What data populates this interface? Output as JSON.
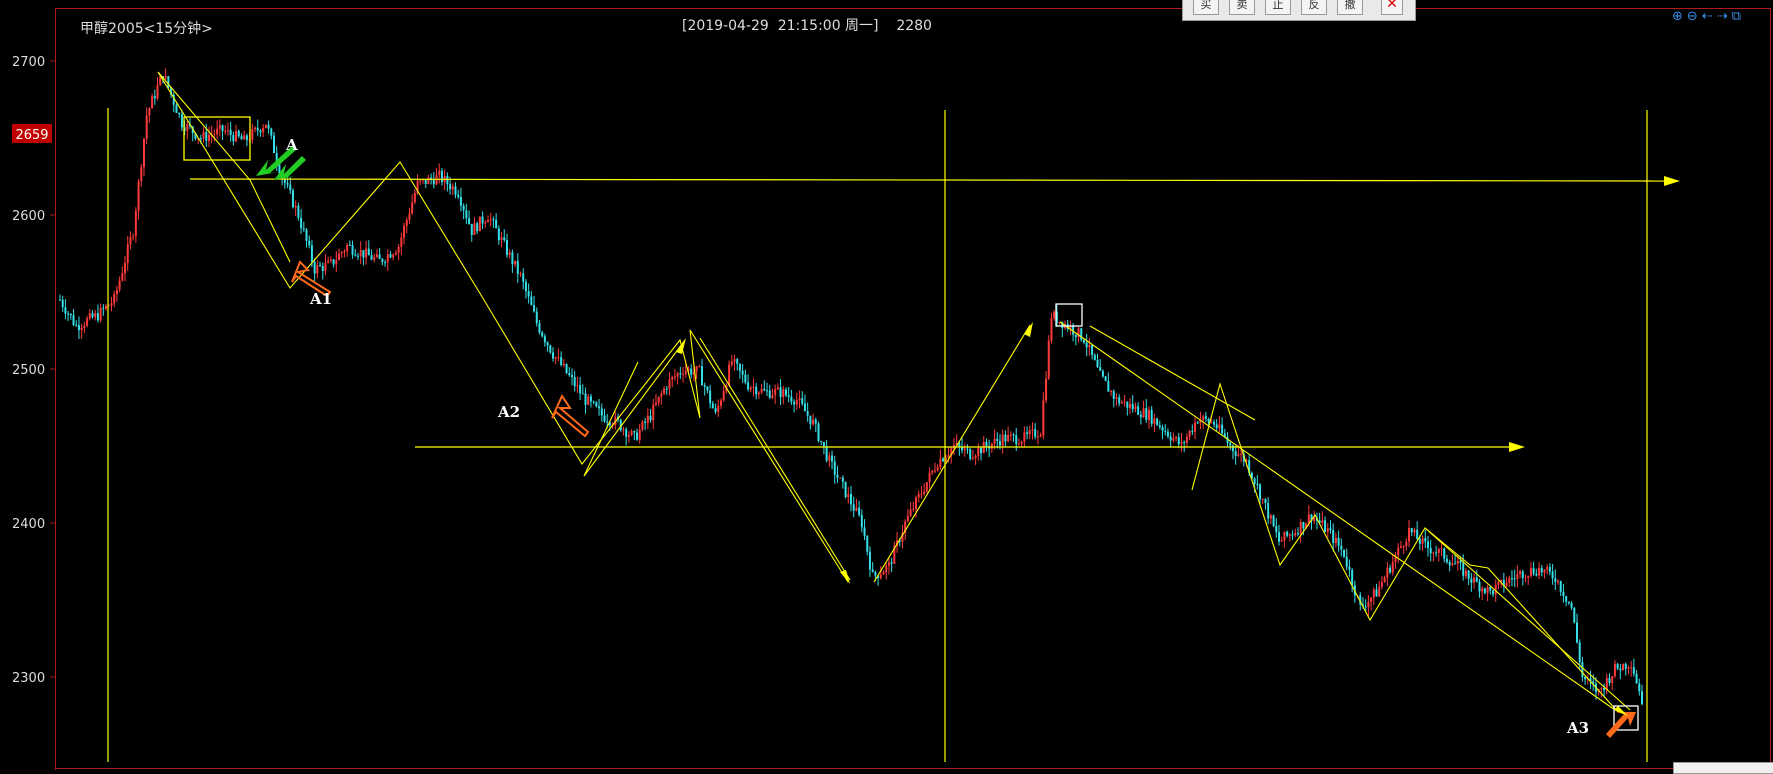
{
  "header": {
    "symbol": "甲醇2005<15分钟>",
    "info": "[2019-04-29  21:15:00 周一]    2280"
  },
  "toolbar": {
    "buttons": [
      "买",
      "卖",
      "止",
      "反",
      "撤"
    ],
    "close_icon": "close-icon"
  },
  "corner_icons": [
    "zoom-in-icon",
    "zoom-out-icon",
    "scroll-left-icon",
    "scroll-right-icon",
    "expand-icon"
  ],
  "price_tag": "2659",
  "annotations": [
    "A",
    "A1",
    "A2",
    "A3"
  ],
  "colors": {
    "background": "#000000",
    "up": "#ff3a3a",
    "down": "#35e0e8",
    "lines": "#ffff00",
    "frame": "#b0191e",
    "label_bg": "#c00000",
    "green_arrow": "#22cc22",
    "orange_arrow": "#ff6a1a"
  },
  "chart_data": {
    "type": "candlestick",
    "title": "甲醇2005<15分钟>",
    "y_ticks": [
      2700,
      2600,
      2500,
      2400,
      2300
    ],
    "ylim": [
      2245,
      2730
    ],
    "highlight_price": 2659,
    "horizontal_levels": [
      2622,
      2448
    ],
    "price_path": [
      [
        0,
        2545
      ],
      [
        6,
        2528
      ],
      [
        14,
        2535
      ],
      [
        20,
        2545
      ],
      [
        27,
        2590
      ],
      [
        32,
        2665
      ],
      [
        38,
        2692
      ],
      [
        45,
        2660
      ],
      [
        52,
        2650
      ],
      [
        60,
        2655
      ],
      [
        68,
        2648
      ],
      [
        76,
        2660
      ],
      [
        82,
        2625
      ],
      [
        88,
        2600
      ],
      [
        94,
        2565
      ],
      [
        100,
        2568
      ],
      [
        106,
        2580
      ],
      [
        112,
        2575
      ],
      [
        118,
        2570
      ],
      [
        125,
        2580
      ],
      [
        132,
        2620
      ],
      [
        140,
        2625
      ],
      [
        147,
        2615
      ],
      [
        152,
        2590
      ],
      [
        158,
        2600
      ],
      [
        164,
        2580
      ],
      [
        170,
        2560
      ],
      [
        176,
        2530
      ],
      [
        182,
        2510
      ],
      [
        188,
        2495
      ],
      [
        194,
        2480
      ],
      [
        200,
        2470
      ],
      [
        206,
        2465
      ],
      [
        212,
        2455
      ],
      [
        218,
        2470
      ],
      [
        224,
        2490
      ],
      [
        230,
        2500
      ],
      [
        236,
        2498
      ],
      [
        242,
        2470
      ],
      [
        248,
        2505
      ],
      [
        254,
        2490
      ],
      [
        260,
        2485
      ],
      [
        266,
        2485
      ],
      [
        272,
        2480
      ],
      [
        278,
        2465
      ],
      [
        284,
        2440
      ],
      [
        290,
        2420
      ],
      [
        296,
        2400
      ],
      [
        300,
        2365
      ],
      [
        306,
        2372
      ],
      [
        312,
        2400
      ],
      [
        318,
        2420
      ],
      [
        324,
        2440
      ],
      [
        330,
        2450
      ],
      [
        336,
        2445
      ],
      [
        342,
        2450
      ],
      [
        348,
        2455
      ],
      [
        356,
        2455
      ],
      [
        362,
        2460
      ],
      [
        366,
        2535
      ],
      [
        372,
        2528
      ],
      [
        378,
        2520
      ],
      [
        384,
        2495
      ],
      [
        390,
        2480
      ],
      [
        396,
        2475
      ],
      [
        402,
        2470
      ],
      [
        408,
        2460
      ],
      [
        414,
        2450
      ],
      [
        420,
        2468
      ],
      [
        426,
        2465
      ],
      [
        432,
        2450
      ],
      [
        438,
        2440
      ],
      [
        444,
        2415
      ],
      [
        450,
        2388
      ],
      [
        456,
        2395
      ],
      [
        462,
        2405
      ],
      [
        468,
        2395
      ],
      [
        474,
        2380
      ],
      [
        480,
        2345
      ],
      [
        486,
        2355
      ],
      [
        492,
        2375
      ],
      [
        498,
        2395
      ],
      [
        504,
        2385
      ],
      [
        510,
        2380
      ],
      [
        516,
        2372
      ],
      [
        522,
        2362
      ],
      [
        528,
        2355
      ],
      [
        534,
        2362
      ],
      [
        540,
        2368
      ],
      [
        546,
        2370
      ],
      [
        552,
        2365
      ],
      [
        558,
        2345
      ],
      [
        562,
        2300
      ],
      [
        568,
        2290
      ],
      [
        574,
        2305
      ],
      [
        580,
        2310
      ],
      [
        584,
        2285
      ]
    ],
    "n_bars": 585
  }
}
